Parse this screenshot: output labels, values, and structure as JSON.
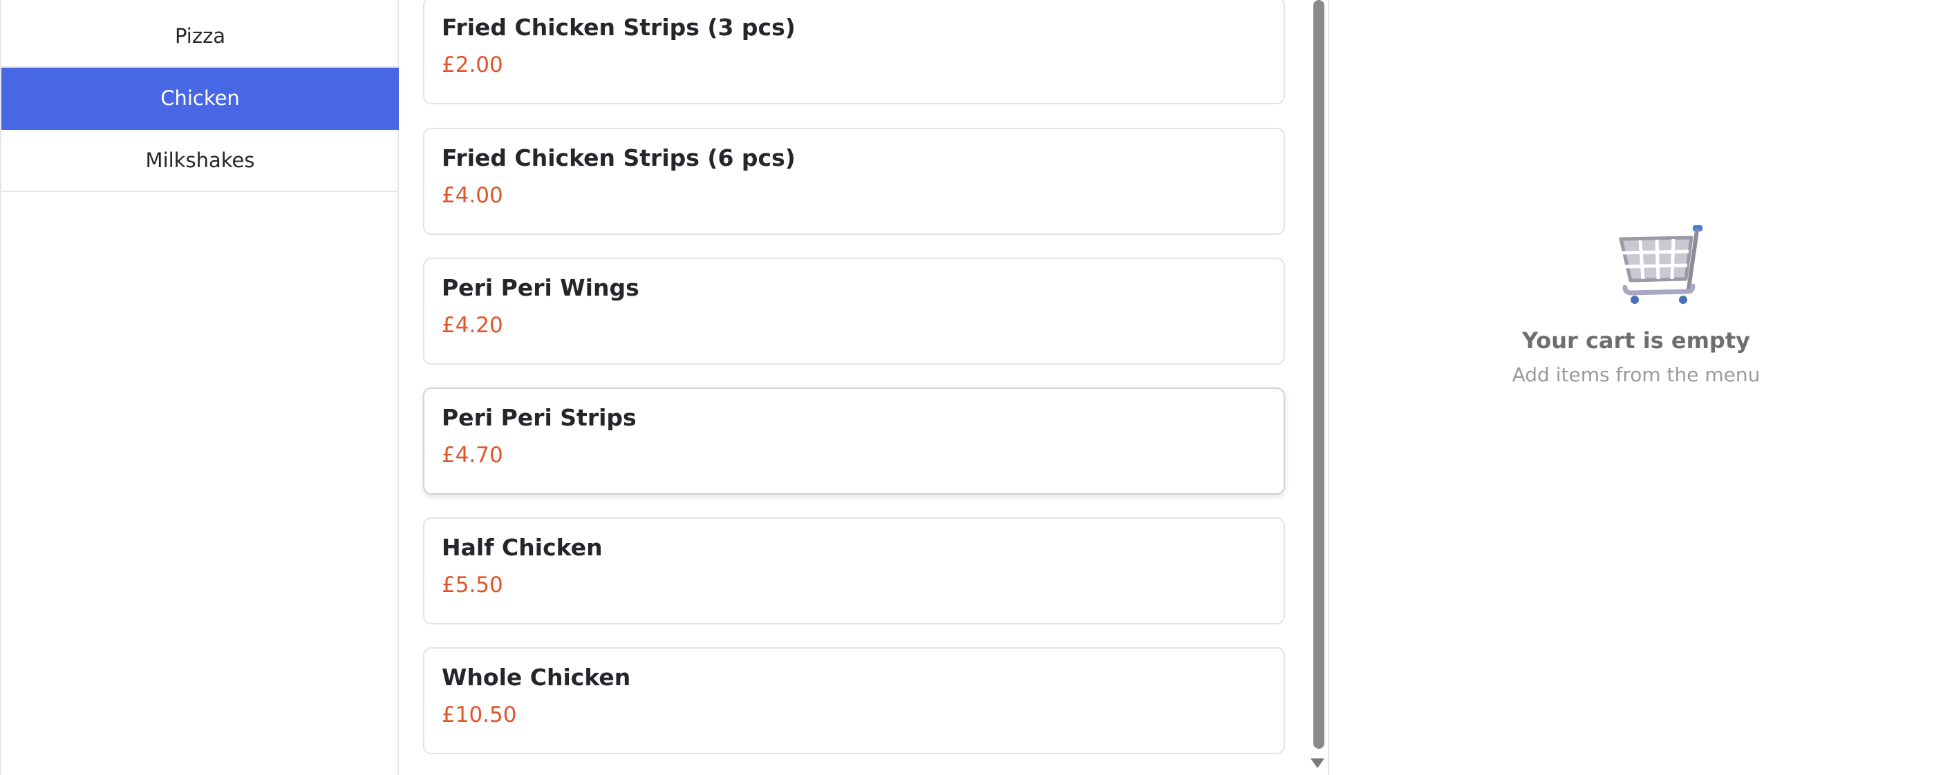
{
  "sidebar": {
    "categories": [
      {
        "label": "Pizza"
      },
      {
        "label": "Chicken"
      },
      {
        "label": "Milkshakes"
      }
    ],
    "active_category": "Chicken",
    "active_color": "#4867e4"
  },
  "menu": {
    "items": [
      {
        "name": "Fried Chicken Strips (3 pcs)",
        "price": "£2.00"
      },
      {
        "name": "Fried Chicken Strips (6 pcs)",
        "price": "£4.00"
      },
      {
        "name": "Peri Peri Wings",
        "price": "£4.20"
      },
      {
        "name": "Peri Peri Strips",
        "price": "£4.70"
      },
      {
        "name": "Half Chicken",
        "price": "£5.50"
      },
      {
        "name": "Whole Chicken",
        "price": "£10.50"
      }
    ],
    "price_color": "#e0562a"
  },
  "cart": {
    "icon": "shopping-cart-icon",
    "empty_title": "Your cart is empty",
    "empty_subtitle": "Add items from the menu"
  }
}
